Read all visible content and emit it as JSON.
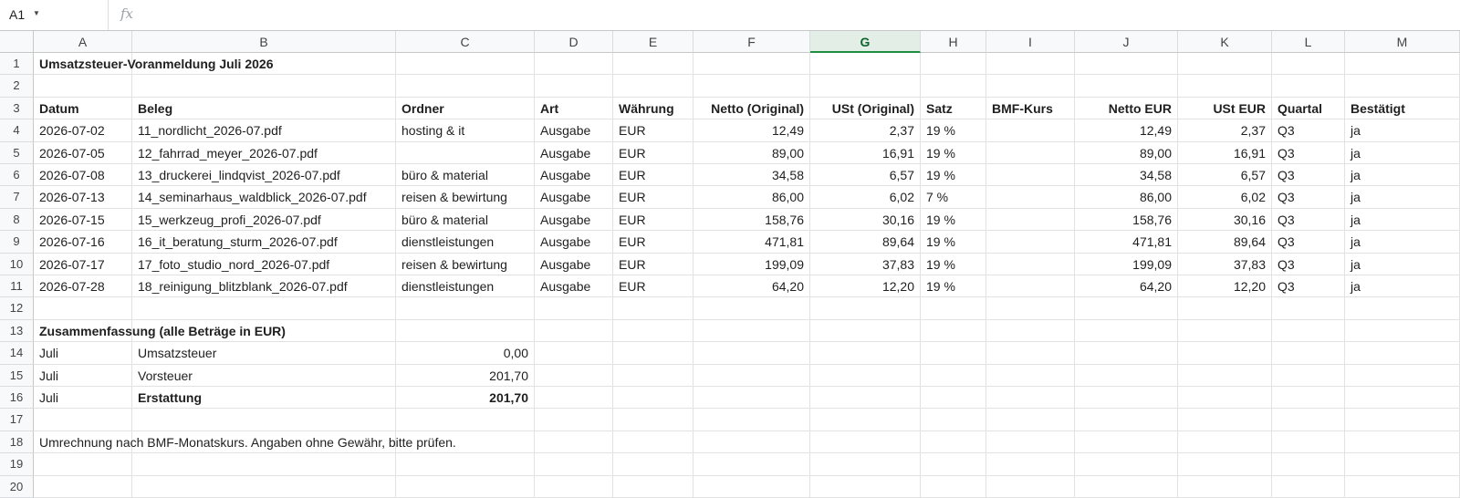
{
  "formula_bar": {
    "cell_ref": "A1",
    "fx_label": "fx",
    "formula": ""
  },
  "columns": [
    "A",
    "B",
    "C",
    "D",
    "E",
    "F",
    "G",
    "H",
    "I",
    "J",
    "K",
    "L",
    "M"
  ],
  "selected_column": "G",
  "rows": [
    {
      "n": "1",
      "cells": [
        {
          "c": "A",
          "v": "Umsatzsteuer-Voranmeldung Juli 2026",
          "bold": true
        }
      ]
    },
    {
      "n": "2",
      "cells": []
    },
    {
      "n": "3",
      "cells": [
        {
          "c": "A",
          "v": "Datum",
          "bold": true
        },
        {
          "c": "B",
          "v": "Beleg",
          "bold": true
        },
        {
          "c": "C",
          "v": "Ordner",
          "bold": true
        },
        {
          "c": "D",
          "v": "Art",
          "bold": true
        },
        {
          "c": "E",
          "v": "Währung",
          "bold": true
        },
        {
          "c": "F",
          "v": "Netto (Original)",
          "bold": true,
          "num": true
        },
        {
          "c": "G",
          "v": "USt (Original)",
          "bold": true,
          "num": true
        },
        {
          "c": "H",
          "v": "Satz",
          "bold": true
        },
        {
          "c": "I",
          "v": "BMF-Kurs",
          "bold": true
        },
        {
          "c": "J",
          "v": "Netto EUR",
          "bold": true,
          "num": true
        },
        {
          "c": "K",
          "v": "USt EUR",
          "bold": true,
          "num": true
        },
        {
          "c": "L",
          "v": "Quartal",
          "bold": true
        },
        {
          "c": "M",
          "v": "Bestätigt",
          "bold": true
        }
      ]
    },
    {
      "n": "4",
      "cells": [
        {
          "c": "A",
          "v": "2026-07-02"
        },
        {
          "c": "B",
          "v": "11_nordlicht_2026-07.pdf"
        },
        {
          "c": "C",
          "v": "hosting & it"
        },
        {
          "c": "D",
          "v": "Ausgabe"
        },
        {
          "c": "E",
          "v": "EUR"
        },
        {
          "c": "F",
          "v": "12,49",
          "num": true
        },
        {
          "c": "G",
          "v": "2,37",
          "num": true
        },
        {
          "c": "H",
          "v": "19 %"
        },
        {
          "c": "J",
          "v": "12,49",
          "num": true
        },
        {
          "c": "K",
          "v": "2,37",
          "num": true
        },
        {
          "c": "L",
          "v": "Q3"
        },
        {
          "c": "M",
          "v": "ja"
        }
      ]
    },
    {
      "n": "5",
      "cells": [
        {
          "c": "A",
          "v": "2026-07-05"
        },
        {
          "c": "B",
          "v": "12_fahrrad_meyer_2026-07.pdf"
        },
        {
          "c": "D",
          "v": "Ausgabe"
        },
        {
          "c": "E",
          "v": "EUR"
        },
        {
          "c": "F",
          "v": "89,00",
          "num": true
        },
        {
          "c": "G",
          "v": "16,91",
          "num": true
        },
        {
          "c": "H",
          "v": "19 %"
        },
        {
          "c": "J",
          "v": "89,00",
          "num": true
        },
        {
          "c": "K",
          "v": "16,91",
          "num": true
        },
        {
          "c": "L",
          "v": "Q3"
        },
        {
          "c": "M",
          "v": "ja"
        }
      ]
    },
    {
      "n": "6",
      "cells": [
        {
          "c": "A",
          "v": "2026-07-08"
        },
        {
          "c": "B",
          "v": "13_druckerei_lindqvist_2026-07.pdf"
        },
        {
          "c": "C",
          "v": "büro & material"
        },
        {
          "c": "D",
          "v": "Ausgabe"
        },
        {
          "c": "E",
          "v": "EUR"
        },
        {
          "c": "F",
          "v": "34,58",
          "num": true
        },
        {
          "c": "G",
          "v": "6,57",
          "num": true
        },
        {
          "c": "H",
          "v": "19 %"
        },
        {
          "c": "J",
          "v": "34,58",
          "num": true
        },
        {
          "c": "K",
          "v": "6,57",
          "num": true
        },
        {
          "c": "L",
          "v": "Q3"
        },
        {
          "c": "M",
          "v": "ja"
        }
      ]
    },
    {
      "n": "7",
      "cells": [
        {
          "c": "A",
          "v": "2026-07-13"
        },
        {
          "c": "B",
          "v": "14_seminarhaus_waldblick_2026-07.pdf"
        },
        {
          "c": "C",
          "v": "reisen & bewirtung"
        },
        {
          "c": "D",
          "v": "Ausgabe"
        },
        {
          "c": "E",
          "v": "EUR"
        },
        {
          "c": "F",
          "v": "86,00",
          "num": true
        },
        {
          "c": "G",
          "v": "6,02",
          "num": true
        },
        {
          "c": "H",
          "v": "7 %"
        },
        {
          "c": "J",
          "v": "86,00",
          "num": true
        },
        {
          "c": "K",
          "v": "6,02",
          "num": true
        },
        {
          "c": "L",
          "v": "Q3"
        },
        {
          "c": "M",
          "v": "ja"
        }
      ]
    },
    {
      "n": "8",
      "cells": [
        {
          "c": "A",
          "v": "2026-07-15"
        },
        {
          "c": "B",
          "v": "15_werkzeug_profi_2026-07.pdf"
        },
        {
          "c": "C",
          "v": "büro & material"
        },
        {
          "c": "D",
          "v": "Ausgabe"
        },
        {
          "c": "E",
          "v": "EUR"
        },
        {
          "c": "F",
          "v": "158,76",
          "num": true
        },
        {
          "c": "G",
          "v": "30,16",
          "num": true
        },
        {
          "c": "H",
          "v": "19 %"
        },
        {
          "c": "J",
          "v": "158,76",
          "num": true
        },
        {
          "c": "K",
          "v": "30,16",
          "num": true
        },
        {
          "c": "L",
          "v": "Q3"
        },
        {
          "c": "M",
          "v": "ja"
        }
      ]
    },
    {
      "n": "9",
      "cells": [
        {
          "c": "A",
          "v": "2026-07-16"
        },
        {
          "c": "B",
          "v": "16_it_beratung_sturm_2026-07.pdf"
        },
        {
          "c": "C",
          "v": "dienstleistungen"
        },
        {
          "c": "D",
          "v": "Ausgabe"
        },
        {
          "c": "E",
          "v": "EUR"
        },
        {
          "c": "F",
          "v": "471,81",
          "num": true
        },
        {
          "c": "G",
          "v": "89,64",
          "num": true
        },
        {
          "c": "H",
          "v": "19 %"
        },
        {
          "c": "J",
          "v": "471,81",
          "num": true
        },
        {
          "c": "K",
          "v": "89,64",
          "num": true
        },
        {
          "c": "L",
          "v": "Q3"
        },
        {
          "c": "M",
          "v": "ja"
        }
      ]
    },
    {
      "n": "10",
      "cells": [
        {
          "c": "A",
          "v": "2026-07-17"
        },
        {
          "c": "B",
          "v": "17_foto_studio_nord_2026-07.pdf"
        },
        {
          "c": "C",
          "v": "reisen & bewirtung"
        },
        {
          "c": "D",
          "v": "Ausgabe"
        },
        {
          "c": "E",
          "v": "EUR"
        },
        {
          "c": "F",
          "v": "199,09",
          "num": true
        },
        {
          "c": "G",
          "v": "37,83",
          "num": true
        },
        {
          "c": "H",
          "v": "19 %"
        },
        {
          "c": "J",
          "v": "199,09",
          "num": true
        },
        {
          "c": "K",
          "v": "37,83",
          "num": true
        },
        {
          "c": "L",
          "v": "Q3"
        },
        {
          "c": "M",
          "v": "ja"
        }
      ]
    },
    {
      "n": "11",
      "cells": [
        {
          "c": "A",
          "v": "2026-07-28"
        },
        {
          "c": "B",
          "v": "18_reinigung_blitzblank_2026-07.pdf"
        },
        {
          "c": "C",
          "v": "dienstleistungen"
        },
        {
          "c": "D",
          "v": "Ausgabe"
        },
        {
          "c": "E",
          "v": "EUR"
        },
        {
          "c": "F",
          "v": "64,20",
          "num": true
        },
        {
          "c": "G",
          "v": "12,20",
          "num": true
        },
        {
          "c": "H",
          "v": "19 %"
        },
        {
          "c": "J",
          "v": "64,20",
          "num": true
        },
        {
          "c": "K",
          "v": "12,20",
          "num": true
        },
        {
          "c": "L",
          "v": "Q3"
        },
        {
          "c": "M",
          "v": "ja"
        }
      ]
    },
    {
      "n": "12",
      "cells": []
    },
    {
      "n": "13",
      "cells": [
        {
          "c": "A",
          "v": "Zusammenfassung (alle Beträge in EUR)",
          "bold": true
        }
      ]
    },
    {
      "n": "14",
      "cells": [
        {
          "c": "A",
          "v": "Juli"
        },
        {
          "c": "B",
          "v": "Umsatzsteuer"
        },
        {
          "c": "C",
          "v": "0,00",
          "num": true
        }
      ]
    },
    {
      "n": "15",
      "cells": [
        {
          "c": "A",
          "v": "Juli"
        },
        {
          "c": "B",
          "v": "Vorsteuer"
        },
        {
          "c": "C",
          "v": "201,70",
          "num": true
        }
      ]
    },
    {
      "n": "16",
      "cells": [
        {
          "c": "A",
          "v": "Juli"
        },
        {
          "c": "B",
          "v": "Erstattung",
          "bold": true
        },
        {
          "c": "C",
          "v": "201,70",
          "num": true,
          "bold": true
        }
      ]
    },
    {
      "n": "17",
      "cells": []
    },
    {
      "n": "18",
      "cells": [
        {
          "c": "A",
          "v": "Umrechnung nach BMF-Monatskurs. Angaben ohne Gewähr, bitte prüfen."
        }
      ]
    },
    {
      "n": "19",
      "cells": []
    },
    {
      "n": "20",
      "cells": []
    }
  ]
}
